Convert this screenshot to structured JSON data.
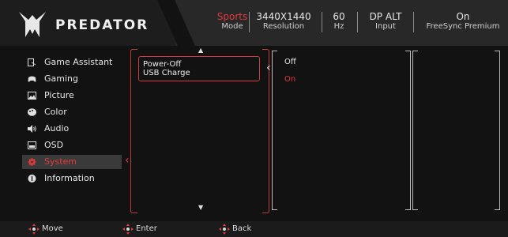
{
  "brand": {
    "name": "PREDATOR"
  },
  "status_bar": [
    {
      "value": "Sports",
      "label": "Mode"
    },
    {
      "value": "3440X1440",
      "label": "Resolution"
    },
    {
      "value": "60",
      "label": "Hz"
    },
    {
      "value": "DP ALT",
      "label": "Input"
    },
    {
      "value": "On",
      "label": "FreeSync Premium"
    }
  ],
  "menu": [
    {
      "label": "Game Assistant",
      "icon": "game-assistant-icon"
    },
    {
      "label": "Gaming",
      "icon": "gamepad-icon"
    },
    {
      "label": "Picture",
      "icon": "picture-icon"
    },
    {
      "label": "Color",
      "icon": "palette-icon"
    },
    {
      "label": "Audio",
      "icon": "speaker-icon"
    },
    {
      "label": "OSD",
      "icon": "osd-icon"
    },
    {
      "label": "System",
      "icon": "gear-icon",
      "selected": true
    },
    {
      "label": "Information",
      "icon": "info-icon"
    }
  ],
  "submenu": {
    "label_line1": "Power-Off",
    "label_line2": "USB Charge"
  },
  "options": [
    {
      "label": "Off",
      "selected": false
    },
    {
      "label": "On",
      "selected": true
    }
  ],
  "footer": [
    {
      "label": "Move"
    },
    {
      "label": "Enter"
    },
    {
      "label": "Back"
    }
  ],
  "colors": {
    "accent": "#e23a3a",
    "background": "#121212",
    "header": "#282828"
  }
}
